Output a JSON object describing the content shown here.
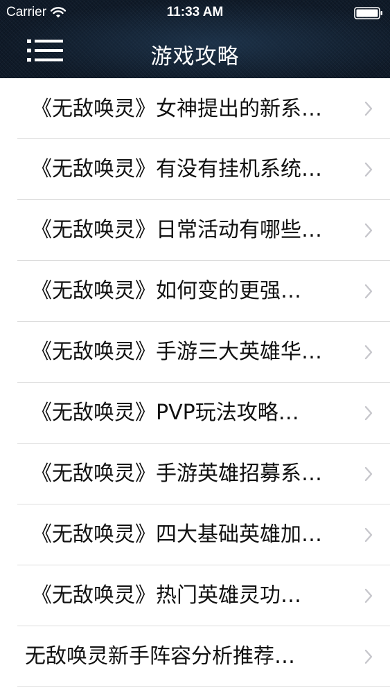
{
  "status_bar": {
    "carrier": "Carrier",
    "time": "11:33 AM"
  },
  "nav": {
    "title": "游戏攻略",
    "menu_icon": "hamburger-menu-icon"
  },
  "articles": [
    {
      "title": "《无敌唤灵》女神提出的新系…"
    },
    {
      "title": "《无敌唤灵》有没有挂机系统…"
    },
    {
      "title": "《无敌唤灵》日常活动有哪些…"
    },
    {
      "title": "《无敌唤灵》如何变的更强…"
    },
    {
      "title": "《无敌唤灵》手游三大英雄华…"
    },
    {
      "title": "《无敌唤灵》PVP玩法攻略…"
    },
    {
      "title": "《无敌唤灵》手游英雄招募系…"
    },
    {
      "title": "《无敌唤灵》四大基础英雄加…"
    },
    {
      "title": "《无敌唤灵》热门英雄灵功…"
    },
    {
      "title": "无敌唤灵新手阵容分析推荐…"
    }
  ],
  "colors": {
    "nav_background": "#0f1a28",
    "title_text": "#ffffff",
    "row_text": "#111111",
    "separator": "#dcdcdc",
    "chevron": "#c7c7cc"
  }
}
